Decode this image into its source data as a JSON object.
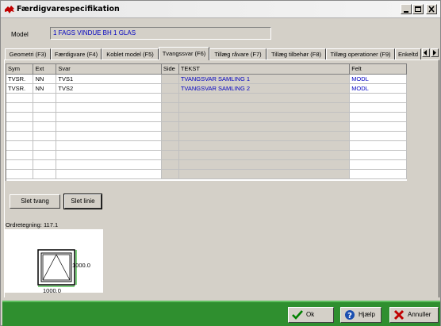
{
  "window": {
    "title": "Færdigvarespecifikation"
  },
  "model": {
    "label": "Model",
    "value": "1 FAGS VINDUE BH 1 GLAS"
  },
  "tabs": [
    {
      "label": "Geometri (F3)"
    },
    {
      "label": "Færdigvare (F4)"
    },
    {
      "label": "Koblet model (F5)"
    },
    {
      "label": "Tvangssvar (F6)"
    },
    {
      "label": "Tillæg råvare (F7)"
    },
    {
      "label": "Tillæg tilbehør (F8)"
    },
    {
      "label": "Tillæg operationer (F9)"
    },
    {
      "label": "Enkeltd"
    }
  ],
  "grid": {
    "columns": [
      "Sym",
      "Ext",
      "Svar",
      "Side",
      "TEKST",
      "Felt"
    ],
    "rows": [
      [
        "TVSR.",
        "NN",
        "TVS1",
        "",
        "TVANGSVAR SAMLING 1",
        "MODL"
      ],
      [
        "TVSR.",
        "NN",
        "TVS2",
        "",
        "TVANGSVAR SAMLING 2",
        "MODL"
      ]
    ]
  },
  "buttons": {
    "delete_constraint": "Slet tvang",
    "delete_line": "Slet linie"
  },
  "preview": {
    "header": "Ordretegning: 117.1",
    "width_dim": "1000.0",
    "height_dim": "1000.0"
  },
  "footer": {
    "ok": "Ok",
    "help": "Hjælp",
    "cancel": "Annuller"
  },
  "colors": {
    "footer_bar": "#2f8f2f",
    "value_text": "#0000c0"
  }
}
